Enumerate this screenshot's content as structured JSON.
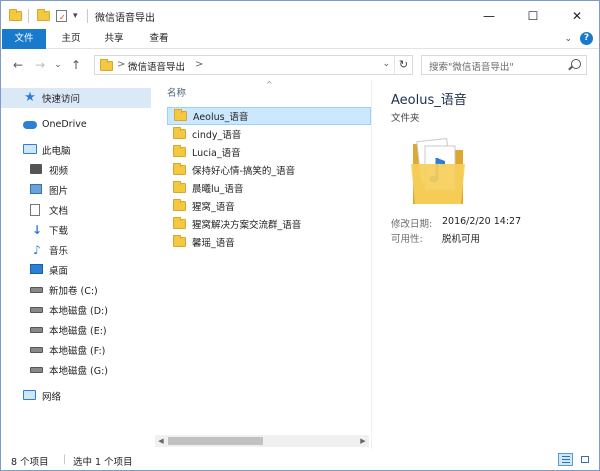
{
  "window": {
    "title": "微信语音导出",
    "minimize_glyph": "—",
    "maximize_glyph": "☐",
    "close_glyph": "✕"
  },
  "ribbon": {
    "tabs": [
      "文件",
      "主页",
      "共享",
      "查看"
    ],
    "expand_glyph": "⌄",
    "help_glyph": "?"
  },
  "address": {
    "back_glyph": "←",
    "forward_glyph": "→",
    "recent_glyph": "⌄",
    "up_glyph": "↑",
    "crumb_sep": ">",
    "crumb": "微信语音导出",
    "dropdown_glyph": "⌄",
    "refresh_glyph": "↻",
    "search_placeholder": "搜索\"微信语音导出\""
  },
  "nav": {
    "items": [
      {
        "label": "快速访问",
        "icon": "star-icon"
      },
      {
        "label": "OneDrive",
        "icon": "cloud-icon"
      },
      {
        "label": "此电脑",
        "icon": "computer-icon"
      },
      {
        "label": "视频",
        "icon": "video-icon"
      },
      {
        "label": "图片",
        "icon": "picture-icon"
      },
      {
        "label": "文档",
        "icon": "document-icon"
      },
      {
        "label": "下载",
        "icon": "download-icon"
      },
      {
        "label": "音乐",
        "icon": "music-icon"
      },
      {
        "label": "桌面",
        "icon": "desktop-icon"
      },
      {
        "label": "新加卷 (C:)",
        "icon": "drive-icon"
      },
      {
        "label": "本地磁盘 (D:)",
        "icon": "drive-icon"
      },
      {
        "label": "本地磁盘 (E:)",
        "icon": "drive-icon"
      },
      {
        "label": "本地磁盘 (F:)",
        "icon": "drive-icon"
      },
      {
        "label": "本地磁盘 (G:)",
        "icon": "drive-icon"
      },
      {
        "label": "网络",
        "icon": "network-icon"
      }
    ]
  },
  "list": {
    "column_name": "名称",
    "sort_glyph": "^",
    "files": [
      "Aeolus_语音",
      "cindy_语音",
      "Lucia_语音",
      "保持好心情-搞笑的_语音",
      "晨曦lu_语音",
      "猩窝_语音",
      "猩窝解决方案交流群_语音",
      "馨瑶_语音"
    ],
    "selected_index": 0
  },
  "details": {
    "name": "Aeolus_语音",
    "type": "文件夹",
    "modified_label": "修改日期:",
    "modified_value": "2016/2/20 14:27",
    "availability_label": "可用性:",
    "availability_value": "脱机可用"
  },
  "status": {
    "count": "8 个项目",
    "selected": "选中 1 个项目"
  },
  "colors": {
    "accent": "#1979ca",
    "folder": "#f5c842",
    "selection": "#cce8ff"
  }
}
